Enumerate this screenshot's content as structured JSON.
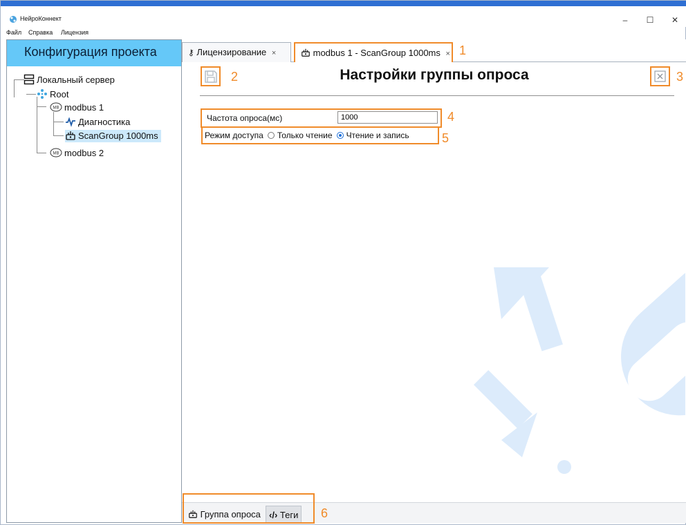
{
  "window": {
    "title": "НейроКоннект",
    "controls": {
      "minimize": "–",
      "maximize": "☐",
      "close": "✕"
    }
  },
  "menu": [
    "Файл",
    "Справка",
    "Лицензия"
  ],
  "sidebar": {
    "header": "Конфигурация проекта",
    "tree": [
      {
        "label": "Локальный сервер",
        "icon": "server-icon"
      },
      {
        "label": "Root",
        "icon": "network-icon"
      },
      {
        "label": "modbus 1",
        "icon": "modbus-icon"
      },
      {
        "label": "Диагностика",
        "icon": "pulse-icon"
      },
      {
        "label": "ScanGroup 1000ms",
        "icon": "scan-group-icon",
        "selected": true
      },
      {
        "label": "modbus 2",
        "icon": "modbus-icon"
      }
    ]
  },
  "tabs": [
    {
      "label": "Лицензирование",
      "icon": "key-icon",
      "close": "×"
    },
    {
      "label": "modbus 1 - ScanGroup 1000ms",
      "icon": "scan-group-icon",
      "close": "×",
      "active": true
    }
  ],
  "content": {
    "title": "Настройки группы опроса",
    "save_icon": "save-icon",
    "close_icon": "close-icon",
    "fields": {
      "frequency_label": "Частота опроса(мс)",
      "frequency_value": "1000",
      "access_label": "Режим доступа",
      "access_options": [
        "Только чтение",
        "Чтение и запись"
      ],
      "access_selected": "Чтение и запись"
    }
  },
  "bottom_tabs": [
    {
      "label": "Группа опроса",
      "icon": "scan-group-icon"
    },
    {
      "label": "Теги",
      "icon": "code-icon"
    }
  ],
  "annotations": [
    "1",
    "2",
    "3",
    "4",
    "5",
    "6"
  ],
  "colors": {
    "accent": "#2e6fd3",
    "sidebar_header": "#65c8f8",
    "annotation": "#f08b2a",
    "selection": "#cce9fb"
  }
}
